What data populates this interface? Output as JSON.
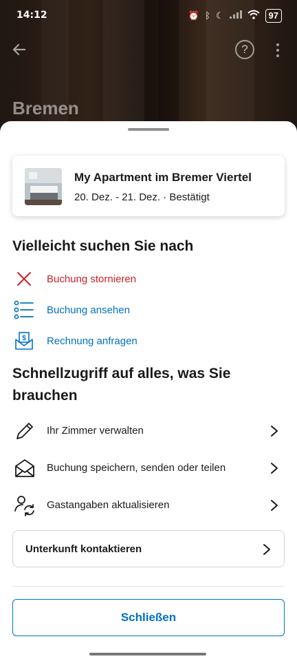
{
  "status_bar": {
    "time": "14:12",
    "battery": "97"
  },
  "header": {
    "city": "Bremen",
    "help_symbol": "?"
  },
  "booking_card": {
    "title": "My Apartment im Bremer Viertel",
    "details": "20. Dez. - 21. Dez. · Bestätigt"
  },
  "suggestions": {
    "title": "Vielleicht suchen Sie nach",
    "items": [
      {
        "label": "Buchung stornieren",
        "icon": "close-x-icon",
        "color": "#cc1f27"
      },
      {
        "label": "Buchung ansehen",
        "icon": "list-icon",
        "color": "#0071c2"
      },
      {
        "label": "Rechnung anfragen",
        "icon": "invoice-envelope-icon",
        "color": "#0071c2"
      }
    ]
  },
  "quick_access": {
    "title_line1": "Schnellzugriff auf alles, was Sie",
    "title_line2": "brauchen",
    "items": [
      {
        "label": "Ihr Zimmer verwalten",
        "icon": "pencil-icon"
      },
      {
        "label": "Buchung speichern, senden oder teilen",
        "icon": "envelope-open-icon"
      },
      {
        "label": "Gastangaben aktualisieren",
        "icon": "person-refresh-icon"
      }
    ]
  },
  "contact": {
    "label": "Unterkunft kontaktieren"
  },
  "close_button": {
    "label": "Schließen"
  },
  "colors": {
    "accent_blue": "#0071c2",
    "danger_red": "#cc1f27"
  }
}
